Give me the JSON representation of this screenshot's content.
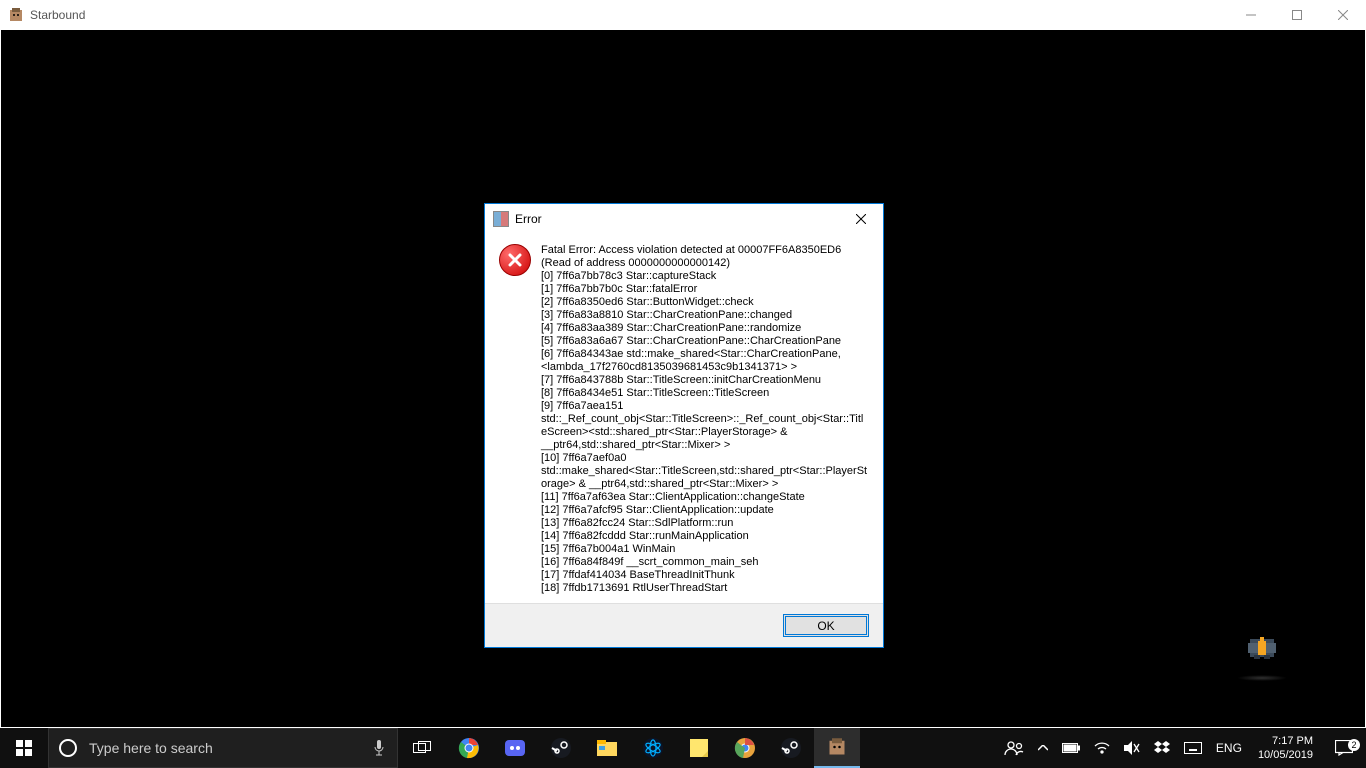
{
  "app": {
    "title": "Starbound"
  },
  "dialog": {
    "title": "Error",
    "ok_label": "OK",
    "message": "Fatal Error: Access violation detected at 00007FF6A8350ED6\n(Read of address 0000000000000142)\n[0] 7ff6a7bb78c3 Star::captureStack\n[1] 7ff6a7bb7b0c Star::fatalError\n[2] 7ff6a8350ed6 Star::ButtonWidget::check\n[3] 7ff6a83a8810 Star::CharCreationPane::changed\n[4] 7ff6a83aa389 Star::CharCreationPane::randomize\n[5] 7ff6a83a6a67 Star::CharCreationPane::CharCreationPane\n[6] 7ff6a84343ae std::make_shared<Star::CharCreationPane,<lambda_17f2760cd8135039681453c9b1341371> >\n[7] 7ff6a843788b Star::TitleScreen::initCharCreationMenu\n[8] 7ff6a8434e51 Star::TitleScreen::TitleScreen\n[9] 7ff6a7aea151 std::_Ref_count_obj<Star::TitleScreen>::_Ref_count_obj<Star::TitleScreen><std::shared_ptr<Star::PlayerStorage> & __ptr64,std::shared_ptr<Star::Mixer> >\n[10] 7ff6a7aef0a0 std::make_shared<Star::TitleScreen,std::shared_ptr<Star::PlayerStorage> & __ptr64,std::shared_ptr<Star::Mixer> >\n[11] 7ff6a7af63ea Star::ClientApplication::changeState\n[12] 7ff6a7afcf95 Star::ClientApplication::update\n[13] 7ff6a82fcc24 Star::SdlPlatform::run\n[14] 7ff6a82fcddd Star::runMainApplication\n[15] 7ff6a7b004a1 WinMain\n[16] 7ff6a84f849f __scrt_common_main_seh\n[17] 7ffdaf414034 BaseThreadInitThunk\n[18] 7ffdb1713691 RtlUserThreadStart"
  },
  "taskbar": {
    "search_placeholder": "Type here to search",
    "language": "ENG",
    "time": "7:17 PM",
    "date": "10/05/2019",
    "notification_count": "2"
  }
}
